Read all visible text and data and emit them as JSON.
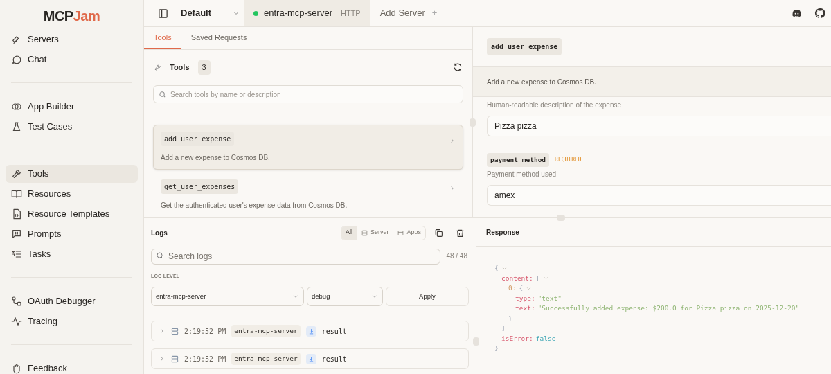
{
  "sidebar": {
    "logo": {
      "part_1": "MCP",
      "part_2": "Jam"
    },
    "groups": [
      [
        {
          "label": "Servers",
          "selected": false
        },
        {
          "label": "Chat",
          "selected": false
        }
      ],
      [
        {
          "label": "App Builder",
          "selected": false
        },
        {
          "label": "Test Cases",
          "selected": false
        }
      ],
      [
        {
          "label": "Tools",
          "selected": true
        },
        {
          "label": "Resources",
          "selected": false
        },
        {
          "label": "Resource Templates",
          "selected": false
        },
        {
          "label": "Prompts",
          "selected": false
        },
        {
          "label": "Tasks",
          "selected": false
        }
      ],
      [
        {
          "label": "OAuth Debugger",
          "selected": false
        },
        {
          "label": "Tracing",
          "selected": false
        }
      ],
      [
        {
          "label": "Feedback",
          "selected": false
        }
      ]
    ]
  },
  "top_bar": {
    "workspace": "Default",
    "tabs": [
      {
        "label": "entra-mcp-server",
        "badge": "HTTP",
        "connected": true,
        "selected": true
      }
    ],
    "add_server": {
      "label": "Add Server",
      "icon": "+"
    }
  },
  "tools_panel": {
    "tabs": [
      {
        "label": "Tools",
        "selected": true
      },
      {
        "label": "Saved Requests",
        "selected": false
      }
    ],
    "title": "Tools",
    "count": "3",
    "search": {
      "placeholder": "Search tools by name or description"
    },
    "tools": [
      {
        "name": "add_user_expense",
        "description": "Add a new expense to Cosmos DB.",
        "selected": true
      },
      {
        "name": "get_user_expenses",
        "description": "Get the authenticated user's expense data from Cosmos DB.",
        "selected": false
      }
    ]
  },
  "tool_detail": {
    "name": "add_user_expense",
    "description": "Add a new expense to Cosmos DB.",
    "params": [
      {
        "hint": "Human-readable description of the expense",
        "value": "Pizza pizza"
      },
      {
        "name": "payment_method",
        "required": "REQUIRED",
        "hint": "Payment method used",
        "value": "amex"
      }
    ]
  },
  "logs": {
    "title": "Logs",
    "filters": [
      {
        "label": "All",
        "selected": true
      },
      {
        "label": "Server",
        "selected": false
      },
      {
        "label": "Apps",
        "selected": false
      }
    ],
    "search": {
      "placeholder": "Search logs"
    },
    "count": "48 / 48",
    "level_label": "LOG LEVEL",
    "server_select": "entra-mcp-server",
    "level_select": "debug",
    "apply": "Apply",
    "entries": [
      {
        "time": "2:19:52 PM",
        "server": "entra-mcp-server",
        "type": "result",
        "expanded": false
      },
      {
        "time": "2:19:52 PM",
        "server": "entra-mcp-server",
        "type": "result",
        "expanded": false
      }
    ]
  },
  "response": {
    "title": "Response",
    "tree": {
      "open": "{",
      "close": "}",
      "expanded": true,
      "children": [
        {
          "key": "content:",
          "open": "[",
          "close": "]",
          "expanded": true,
          "children": [
            {
              "key": "0:",
              "open": "{",
              "close": "}",
              "kind": "index",
              "expanded": true,
              "children": [
                {
                  "key": "type:",
                  "value": "\"text\"",
                  "kind": "string"
                },
                {
                  "key": "text:",
                  "value": "\"Successfully added expense: $200.0 for Pizza pizza on 2025-12-20\"",
                  "kind": "string"
                }
              ]
            }
          ]
        },
        {
          "key": "isError:",
          "value": "false",
          "kind": "boolean"
        }
      ]
    }
  }
}
